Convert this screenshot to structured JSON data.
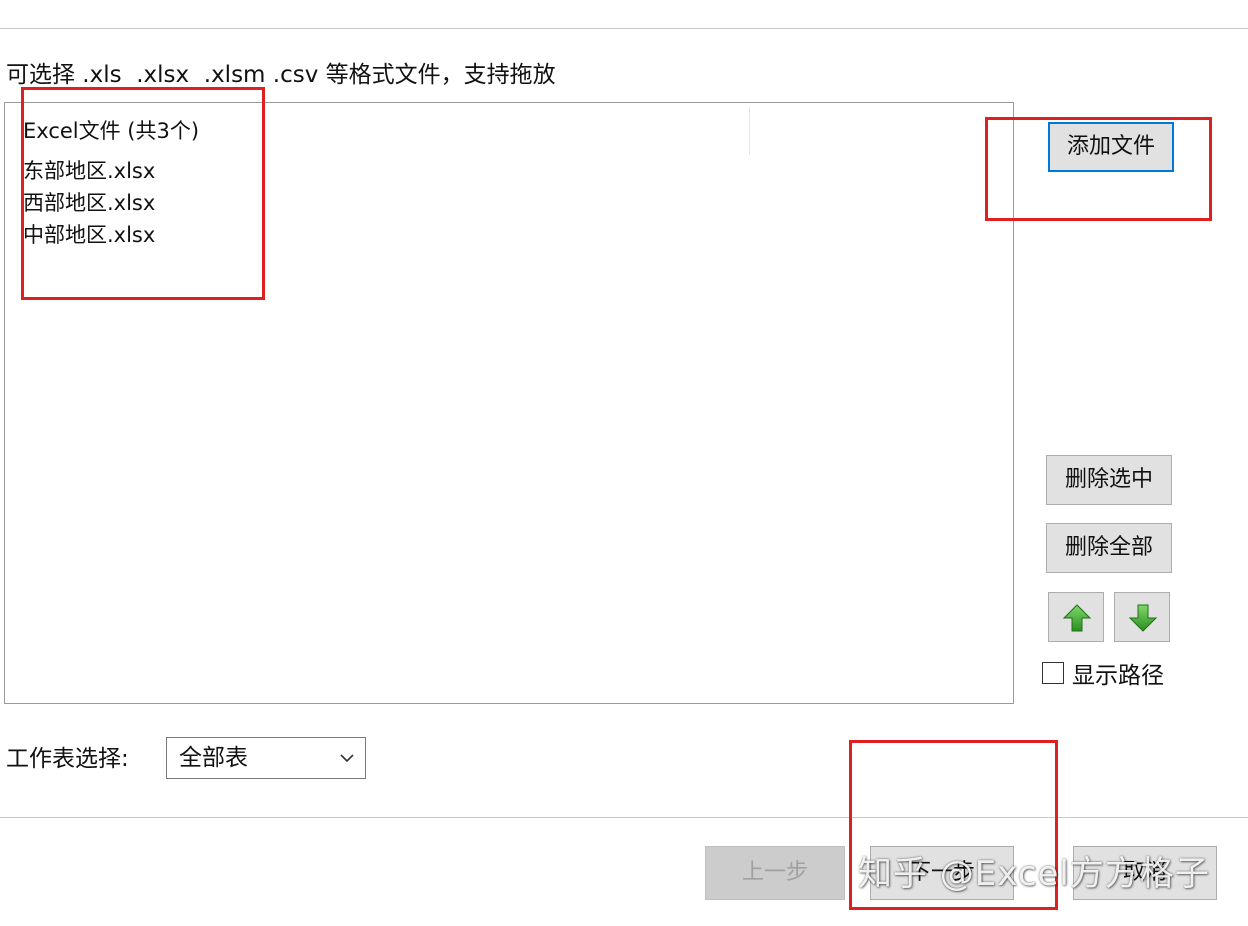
{
  "hint_text": "可选择 .xls  .xlsx  .xlsm .csv 等格式文件，支持拖放",
  "file_list": {
    "header": "Excel文件 (共3个)",
    "items": [
      "东部地区.xlsx",
      "西部地区.xlsx",
      "中部地区.xlsx"
    ]
  },
  "buttons": {
    "add_files": "添加文件",
    "delete_selected": "删除选中",
    "delete_all": "删除全部",
    "prev": "上一步",
    "next": "下一步",
    "cancel": "取消"
  },
  "icons": {
    "move_up": "arrow-up-icon",
    "move_down": "arrow-down-icon",
    "dropdown": "chevron-down-icon"
  },
  "show_path": {
    "label": "显示路径",
    "checked": false
  },
  "sheet_select": {
    "label": "工作表选择:",
    "value": "全部表"
  },
  "watermark": "知乎 @Excel方方格子",
  "colors": {
    "highlight": "#e02020",
    "accent": "#0078d7",
    "arrow_green": "#3cab2c"
  }
}
